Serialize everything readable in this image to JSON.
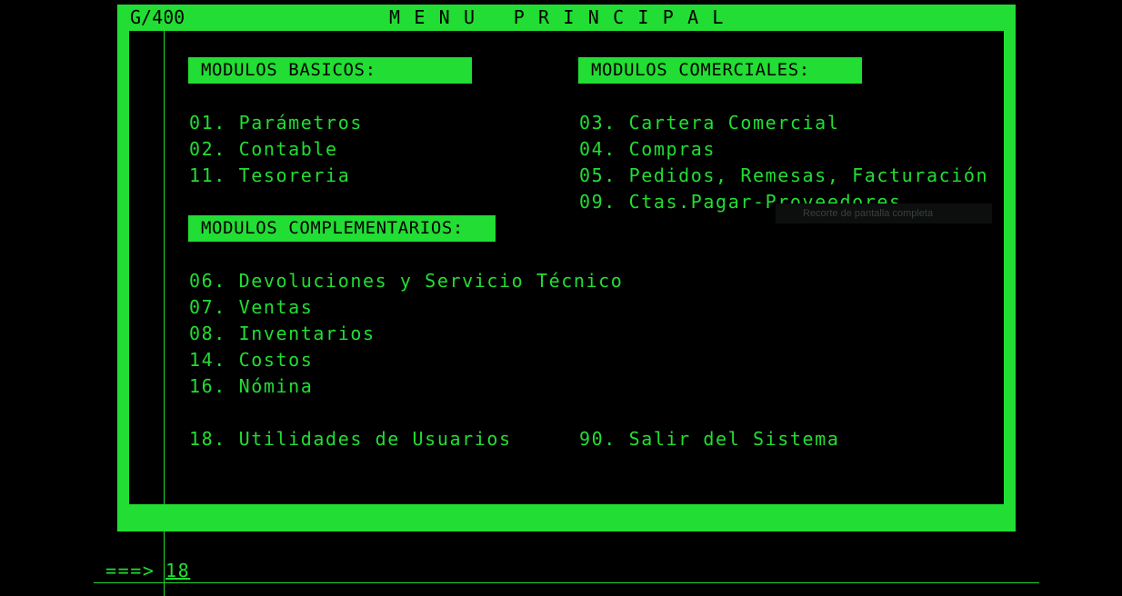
{
  "header": {
    "system_id": "G/400",
    "title": "MENU PRINCIPAL"
  },
  "sections": {
    "basicos": {
      "label": "MODULOS BASICOS:"
    },
    "comerciales": {
      "label": "MODULOS COMERCIALES:"
    },
    "complementarios": {
      "label": "MODULOS COMPLEMENTARIOS:"
    }
  },
  "items": {
    "parametros": "01. Parámetros",
    "contable": "02. Contable",
    "tesoreria": "11. Tesoreria",
    "cartera": "03. Cartera Comercial",
    "compras": "04. Compras",
    "pedidos": "05. Pedidos, Remesas, Facturación",
    "ctas_pagar": "09. Ctas.Pagar-Proveedores",
    "devoluciones": "06. Devoluciones y Servicio Técnico",
    "ventas": "07. Ventas",
    "inventarios": "08. Inventarios",
    "costos": "14. Costos",
    "nomina": "16. Nómina",
    "utilidades": "18. Utilidades de Usuarios",
    "salir": "90. Salir del Sistema"
  },
  "command": {
    "prompt": "===>",
    "value": "18"
  },
  "tooltip": {
    "text": "Recorte de pantalla completa"
  },
  "colors": {
    "terminal_green": "#22dd33",
    "background": "#000000"
  }
}
